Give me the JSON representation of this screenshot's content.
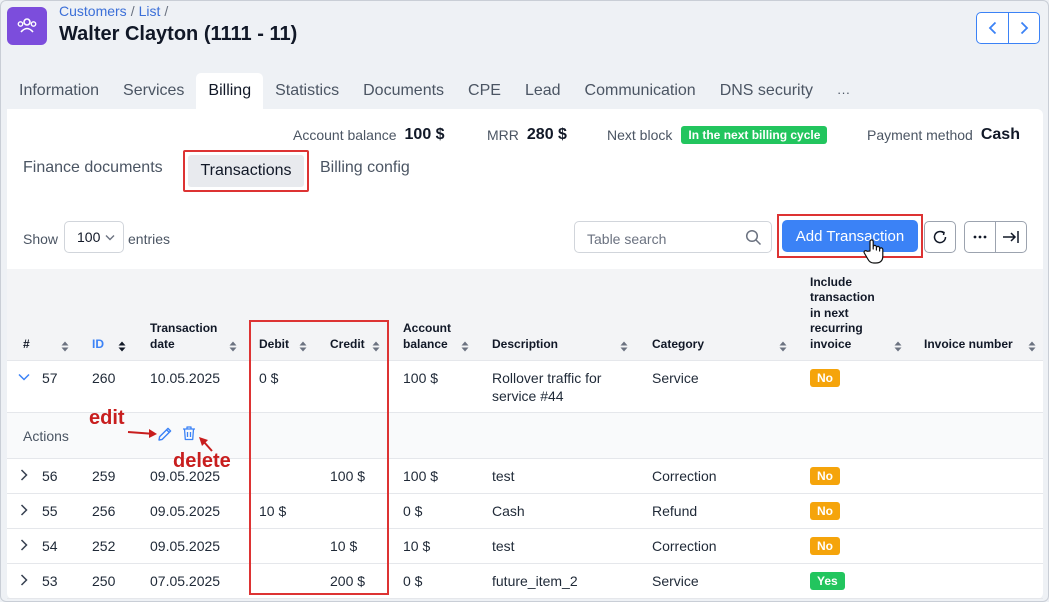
{
  "header": {
    "breadcrumb": [
      "Customers",
      "List"
    ],
    "title": "Walter Clayton (1111 - 11)"
  },
  "tabs": [
    "Information",
    "Services",
    "Billing",
    "Statistics",
    "Documents",
    "CPE",
    "Lead",
    "Communication",
    "DNS security",
    "···"
  ],
  "active_tab": "Billing",
  "summary": {
    "account_balance_label": "Account balance",
    "account_balance": "100 $",
    "mrr_label": "MRR",
    "mrr": "280 $",
    "next_block_label": "Next block",
    "next_block": "In the next billing cycle",
    "payment_method_label": "Payment method",
    "payment_method": "Cash"
  },
  "subtabs": {
    "finance": "Finance documents",
    "transactions": "Transactions",
    "billing_config": "Billing config"
  },
  "controls": {
    "show": "Show",
    "entries_value": "100",
    "entries": "entries",
    "search_placeholder": "Table search",
    "add_label": "Add Transaction"
  },
  "table": {
    "headers": {
      "num": "#",
      "id": "ID",
      "date": "Transaction date",
      "debit": "Debit",
      "credit": "Credit",
      "balance": "Account balance",
      "description": "Description",
      "category": "Category",
      "include": "Include transaction in next recurring invoice",
      "invoice": "Invoice number"
    },
    "rows": [
      {
        "num": "57",
        "id": "260",
        "date": "10.05.2025",
        "debit": "0 $",
        "credit": "",
        "balance": "100 $",
        "description": "Rollover traffic for service #44",
        "category": "Service",
        "include": "No"
      },
      {
        "num": "56",
        "id": "259",
        "date": "09.05.2025",
        "debit": "",
        "credit": "100 $",
        "balance": "100 $",
        "description": "test",
        "category": "Correction",
        "include": "No"
      },
      {
        "num": "55",
        "id": "256",
        "date": "09.05.2025",
        "debit": "10 $",
        "credit": "",
        "balance": "0 $",
        "description": "Cash",
        "category": "Refund",
        "include": "No"
      },
      {
        "num": "54",
        "id": "252",
        "date": "09.05.2025",
        "debit": "",
        "credit": "10 $",
        "balance": "10 $",
        "description": "test",
        "category": "Correction",
        "include": "No"
      },
      {
        "num": "53",
        "id": "250",
        "date": "07.05.2025",
        "debit": "",
        "credit": "200 $",
        "balance": "0 $",
        "description": "future_item_2",
        "category": "Service",
        "include": "Yes"
      }
    ],
    "actions_label": "Actions"
  },
  "annotations": {
    "edit": "edit",
    "delete": "delete"
  },
  "colors": {
    "accent": "#3b82f6",
    "highlight": "#dd3333",
    "badge_no": "#f5a40b",
    "badge_yes": "#22c55e",
    "app_icon": "#7c4ddc"
  }
}
